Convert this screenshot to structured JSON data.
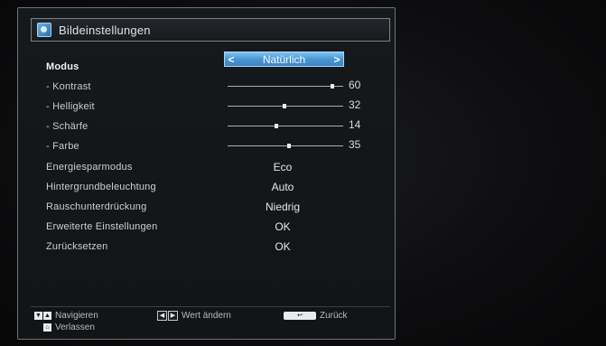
{
  "window": {
    "title": "Bildeinstellungen",
    "title_icon": "picture-settings-icon"
  },
  "menu": {
    "modus": {
      "label": "Modus",
      "value": "Natürlich"
    },
    "kontrast": {
      "label": "- Kontrast",
      "value": "60",
      "level": 0.92
    },
    "helligkeit": {
      "label": "- Helligkeit",
      "value": "32",
      "level": 0.49
    },
    "schaerfe": {
      "label": "- Schärfe",
      "value": "14",
      "level": 0.42
    },
    "farbe": {
      "label": "- Farbe",
      "value": "35",
      "level": 0.53
    },
    "energiespar": {
      "label": "Energiesparmodus",
      "value": "Eco"
    },
    "hintergrund": {
      "label": "Hintergrundbeleuchtung",
      "value": "Auto"
    },
    "rauschunter": {
      "label": "Rauschunterdrückung",
      "value": "Niedrig"
    },
    "erweitert": {
      "label": "Erweiterte Einstellungen",
      "value": "OK"
    },
    "zuruecksetzen": {
      "label": "Zurücksetzen",
      "value": "OK"
    }
  },
  "footer": {
    "navigate": "Navigieren",
    "change_value": "Wert ändern",
    "back": "Zurück",
    "exit": "Verlassen"
  },
  "colors": {
    "selection": "#4a96d4",
    "panel_border": "#6d7378",
    "text": "#cdd1d4"
  }
}
